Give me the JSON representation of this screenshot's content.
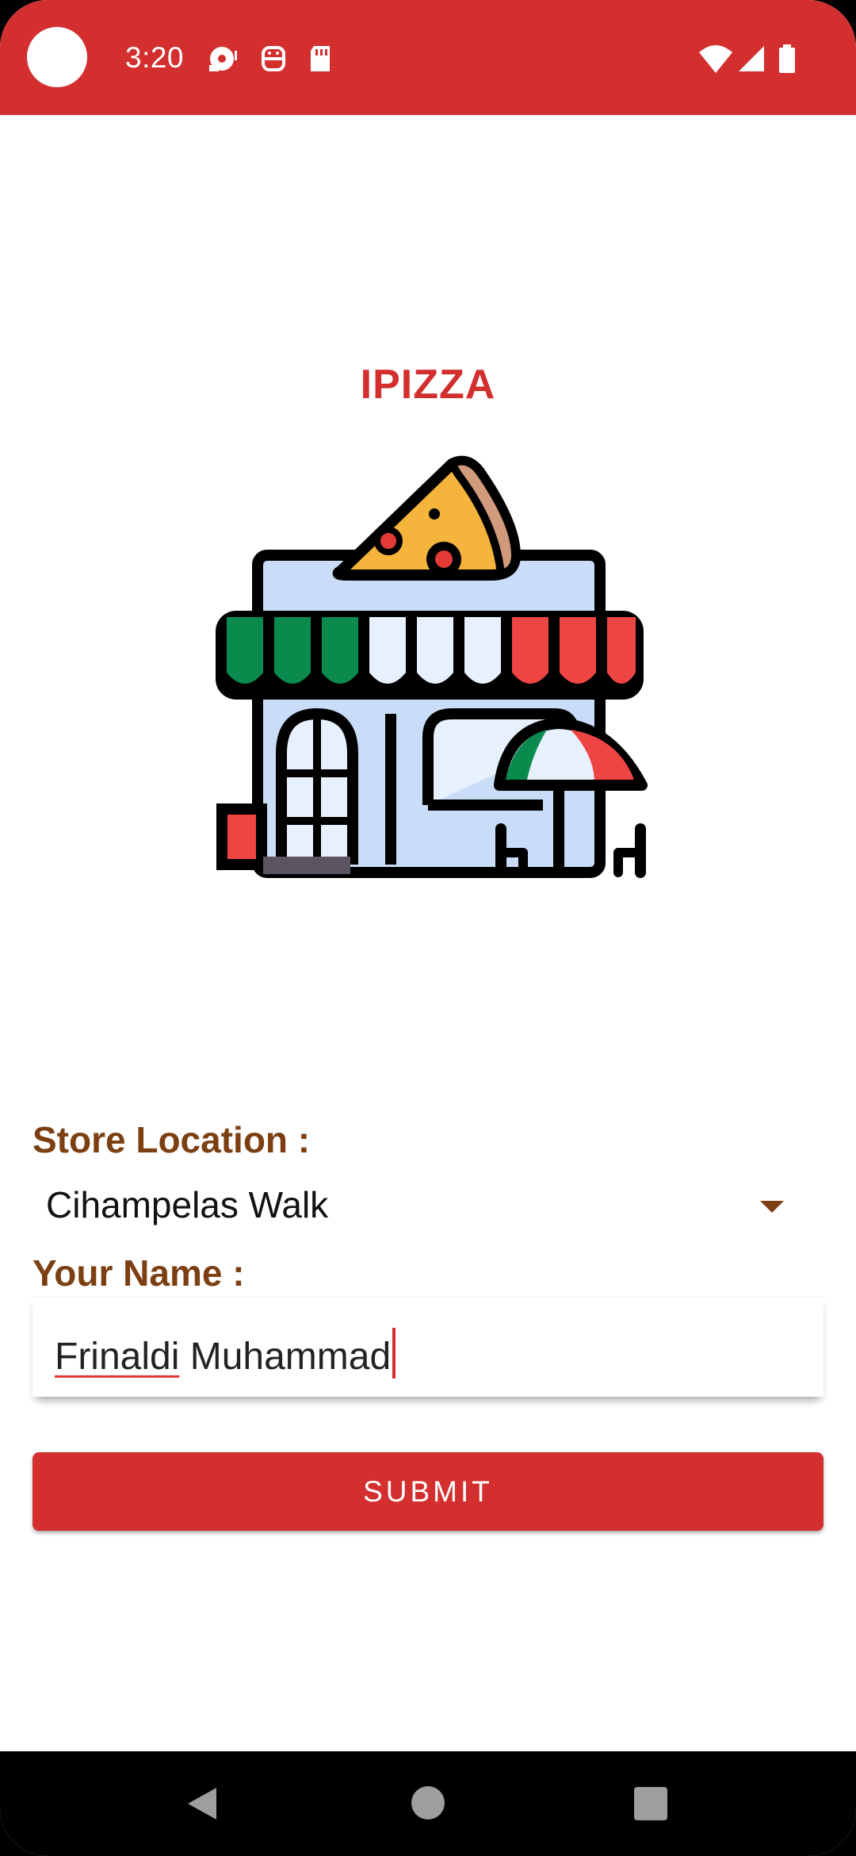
{
  "status_bar": {
    "time": "3:20",
    "left_icons": [
      "podcast-icon",
      "android-debug-icon",
      "sd-card-icon"
    ],
    "right_icons": [
      "wifi-icon",
      "signal-icon",
      "battery-icon"
    ],
    "color": "#d32f2f"
  },
  "app": {
    "title": "IPIZZA",
    "logo_icon": "pizza-store-icon"
  },
  "form": {
    "store_location_label": "Store Location :",
    "store_location_value": "Cihampelas Walk",
    "name_label": "Your Name :",
    "name_value_first": "Frinaldi",
    "name_value_rest": " Muhammad",
    "submit_label": "SUBMIT"
  },
  "nav_bar": {
    "icons": [
      "back-icon",
      "home-icon",
      "recents-icon"
    ]
  },
  "colors": {
    "accent": "#d32f2f",
    "label": "#7b3f12"
  }
}
